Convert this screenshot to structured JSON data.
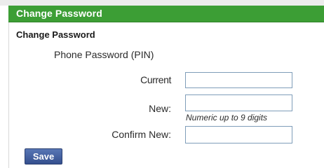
{
  "header": {
    "title": "Change Password"
  },
  "form": {
    "section_title": "Change Password",
    "subsection_label": "Phone Password (PIN)",
    "fields": {
      "current": {
        "label": "Current",
        "value": ""
      },
      "new": {
        "label": "New:",
        "value": "",
        "hint": "Numeric up to 9 digits"
      },
      "confirm": {
        "label": "Confirm New:",
        "value": ""
      }
    },
    "save_label": "Save"
  },
  "colors": {
    "header_bg": "#3c9e35",
    "button_bg": "#4563a2"
  }
}
